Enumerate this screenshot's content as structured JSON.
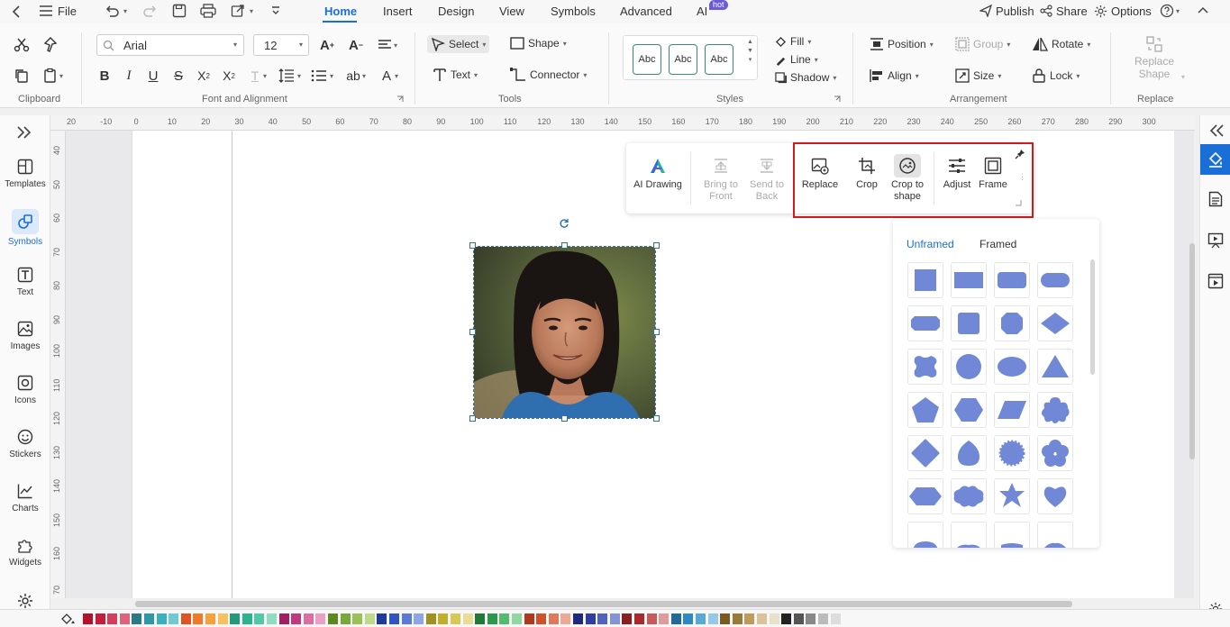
{
  "menubar": {
    "file": "File",
    "tabs": [
      {
        "label": "Home"
      },
      {
        "label": "Insert"
      },
      {
        "label": "Design"
      },
      {
        "label": "View"
      },
      {
        "label": "Symbols"
      },
      {
        "label": "Advanced"
      },
      {
        "label": "AI"
      }
    ],
    "hot_badge": "hot",
    "publish": "Publish",
    "share": "Share",
    "options": "Options"
  },
  "ribbon": {
    "clipboard_label": "Clipboard",
    "font_family": "Arial",
    "font_size": "12",
    "font_group_label": "Font and Alignment",
    "select": "Select",
    "shape": "Shape",
    "text": "Text",
    "connector": "Connector",
    "tools_label": "Tools",
    "style_samples": [
      "Abc",
      "Abc",
      "Abc"
    ],
    "fill": "Fill",
    "line": "Line",
    "shadow": "Shadow",
    "styles_label": "Styles",
    "position": "Position",
    "group": "Group",
    "rotate": "Rotate",
    "align": "Align",
    "size": "Size",
    "lock": "Lock",
    "arrangement_label": "Arrangement",
    "replace_shape_1": "Replace",
    "replace_shape_2": "Shape",
    "replace_label": "Replace"
  },
  "leftbar": {
    "items": [
      {
        "label": "Templates"
      },
      {
        "label": "Symbols"
      },
      {
        "label": "Text"
      },
      {
        "label": "Images"
      },
      {
        "label": "Icons"
      },
      {
        "label": "Stickers"
      },
      {
        "label": "Charts"
      },
      {
        "label": "Widgets"
      }
    ]
  },
  "rulers": {
    "h": [
      "20",
      "-10",
      "0",
      "10",
      "20",
      "30",
      "40",
      "50",
      "60",
      "70",
      "80",
      "90",
      "100",
      "110",
      "120",
      "130",
      "140",
      "150",
      "160",
      "170",
      "180",
      "190",
      "200",
      "210",
      "220",
      "230",
      "240",
      "250",
      "260",
      "270",
      "280",
      "290",
      "300"
    ],
    "v": [
      "40",
      "50",
      "60",
      "70",
      "80",
      "90",
      "100",
      "110",
      "120",
      "130",
      "140",
      "150",
      "160",
      "70"
    ]
  },
  "floatbar": {
    "ai_drawing": "AI Drawing",
    "bring_front_1": "Bring to",
    "bring_front_2": "Front",
    "send_back_1": "Send to",
    "send_back_2": "Back",
    "replace": "Replace",
    "crop": "Crop",
    "crop_shape_1": "Crop to",
    "crop_shape_2": "shape",
    "adjust": "Adjust",
    "frame": "Frame"
  },
  "shapepanel": {
    "tab_unframed": "Unframed",
    "tab_framed": "Framed",
    "shape_color": "#7088d6",
    "shapes": [
      "square",
      "wide-rect",
      "rounded-rect",
      "pill",
      "octagon-rounded",
      "rounded-square",
      "rounded-octagon",
      "diamond",
      "cross-blob",
      "circle",
      "ellipse",
      "triangle",
      "pentagon",
      "hexagon",
      "parallelogram",
      "cloud",
      "diamond-rounded",
      "egg",
      "scalloped-circle",
      "flower",
      "long-hexagon",
      "cloud-wide",
      "star",
      "heart",
      "partial-a",
      "partial-b",
      "partial-c",
      "partial-d"
    ]
  },
  "colors": {
    "accent": "#1a6fd6",
    "highlight_box": "#d11a1a"
  },
  "palette": [
    "#b3142c",
    "#c51d3c",
    "#d63d5a",
    "#e0627a",
    "#2a7a85",
    "#2e98a6",
    "#3ab0bf",
    "#6fcad4",
    "#e0541f",
    "#f07a2a",
    "#f5a03a",
    "#f7c05c",
    "#1f9a7a",
    "#2bb58f",
    "#52c9a6",
    "#8fdcc2",
    "#a01f63",
    "#c13a7d",
    "#db6ea3",
    "#eaa0c4",
    "#5a8a1f",
    "#77a83a",
    "#9ac05a",
    "#c0d88a",
    "#1f3a9a",
    "#2f55bf",
    "#5a7ad6",
    "#8fa6e6",
    "#a0901f",
    "#c0ad2a",
    "#d8c85a",
    "#e8dc96",
    "#1f7a3a",
    "#2a9a4a",
    "#52bb6e",
    "#8fd6a0",
    "#b03a1f",
    "#d0502a",
    "#e0785a",
    "#ecaa96",
    "#1f2a7a",
    "#2f3fa0",
    "#4f62c0",
    "#8592d6",
    "#8a1f1f",
    "#a82a2a",
    "#c85a5a",
    "#e09a9a",
    "#1f6a9a",
    "#2f88bf",
    "#5aa8d6",
    "#96c8e8",
    "#7a5a1f",
    "#9a7a3a",
    "#bf9a5a",
    "#dcc29a",
    "#e8e0c8",
    "#222222",
    "#555555",
    "#888888",
    "#bbbbbb",
    "#dddddd"
  ]
}
